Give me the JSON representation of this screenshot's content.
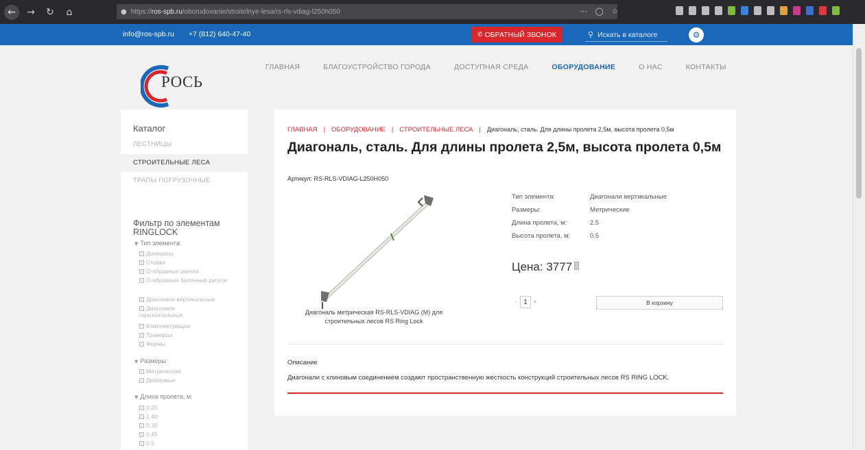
{
  "browser": {
    "url_prefix": "https://",
    "url_host": "ros-spb.ru",
    "url_path": "/oborudovanie/stroitelnye-lesa/rs-rls-vdiag-l250h050",
    "icons": [
      "back-icon",
      "forward-icon",
      "reload-icon",
      "home-icon",
      "lock-icon",
      "more-icon",
      "shield-icon",
      "star-icon"
    ]
  },
  "topbar": {
    "email": "info@ros-spb.ru",
    "phone": "+7 (812) 640-47-40",
    "callback_label": "ОБРАТНЫЙ ЗВОНОК",
    "search_placeholder": "Искать в каталоге"
  },
  "logo": {
    "text": "РОСЬ"
  },
  "nav": {
    "items": [
      "ГЛАВНАЯ",
      "БЛАГОУСТРОЙСТВО ГОРОДА",
      "ДОСТУПНАЯ СРЕДА",
      "ОБОРУДОВАНИЕ",
      "О НАС",
      "КОНТАКТЫ"
    ],
    "active": "ОБОРУДОВАНИЕ"
  },
  "sidebar": {
    "catalog_title": "Каталог",
    "categories": [
      "ЛЕСТНИЦЫ",
      "СТРОИТЕЛЬНЫЕ ЛЕСА",
      "ТРАПЫ ПОГРУЗОЧНЫЕ"
    ],
    "filter_title": "Фильтр по элементам RINGLOCK",
    "groups": [
      {
        "name": "Тип элемента:",
        "options": [
          "Домкраты",
          "Стойки",
          "О-образные ригели",
          "О-образные балочные ригели",
          "Диагонали вертикальные",
          "Диагонали горизонтальные",
          "Комплектующие",
          "Траверсы",
          "Фермы"
        ]
      },
      {
        "name": "Размеры:",
        "options": [
          "Метрические",
          "Дюймовые"
        ]
      },
      {
        "name": "Длина пролета, м:",
        "options": [
          "0.25",
          "1.40",
          "0.30",
          "0.45",
          "0.5"
        ]
      }
    ]
  },
  "product": {
    "breadcrumb": [
      "ГЛАВНАЯ",
      "ОБОРУДОВАНИЕ",
      "СТРОИТЕЛЬНЫЕ ЛЕСА"
    ],
    "breadcrumb_current": "Диагональ, сталь. Для длины пролета 2,5м, высота пролета 0,5м",
    "title": "Диагональ, сталь. Для длины пролета 2,5м, высота пролета 0,5м",
    "article": "Артикул: RS-RLS-VDIAG-L250H050",
    "caption": "Диагональ метрическая RS-RLS-VDIAG (M) для строительных лесов RS Ring Lock",
    "properties": [
      {
        "k": "Тип элемента:",
        "v": "Диагонали вертикальные"
      },
      {
        "k": "Размеры:",
        "v": "Метрические"
      },
      {
        "k": "Длина пролета, м:",
        "v": "2.5"
      },
      {
        "k": "Высота пролета, м:",
        "v": "0.5"
      }
    ],
    "price_label": "Цена: 3777",
    "qty_minus": "-",
    "qty_value": "1",
    "qty_plus": "+",
    "cart_label": "В корзину",
    "desc_label": "Описание",
    "desc_text": "Диагонали с клиновым соединением создают пространственную жесткость конструкций строительных лесов RS RING LOCK."
  }
}
